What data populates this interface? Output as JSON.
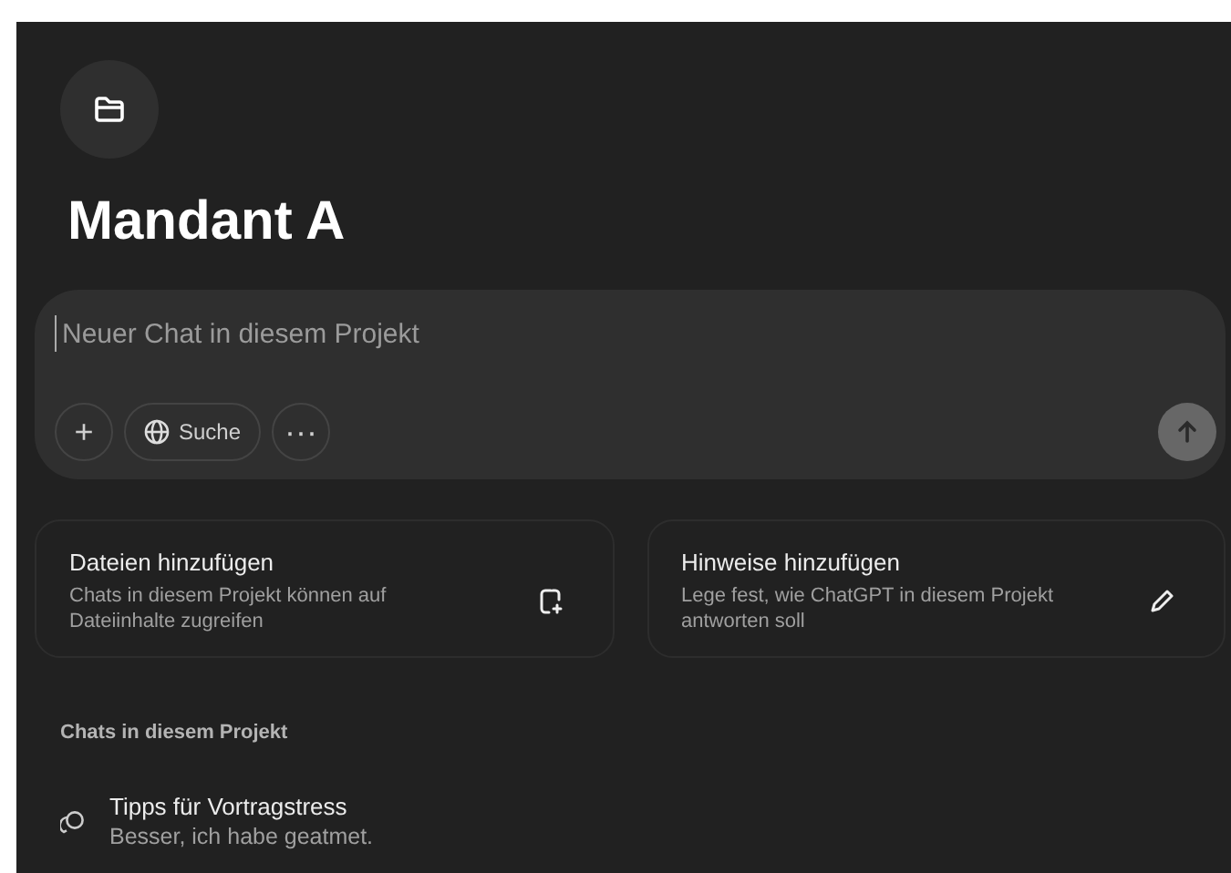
{
  "project": {
    "title": "Mandant A"
  },
  "composer": {
    "placeholder": "Neuer Chat in diesem Projekt",
    "search_label": "Suche",
    "plus": "+",
    "more": "···"
  },
  "cards": [
    {
      "kind": "files",
      "title": "Dateien hinzufügen",
      "text": "Chats in diesem Projekt können auf Dateiinhalte zugreifen"
    },
    {
      "kind": "instructions",
      "title": "Hinweise hinzufügen",
      "text": "Lege fest, wie ChatGPT in diesem Projekt antworten soll"
    }
  ],
  "chats_heading": "Chats in diesem Projekt",
  "chats": [
    {
      "title": "Tipps für Vortragstress",
      "preview": "Besser, ich habe geatmet."
    }
  ]
}
